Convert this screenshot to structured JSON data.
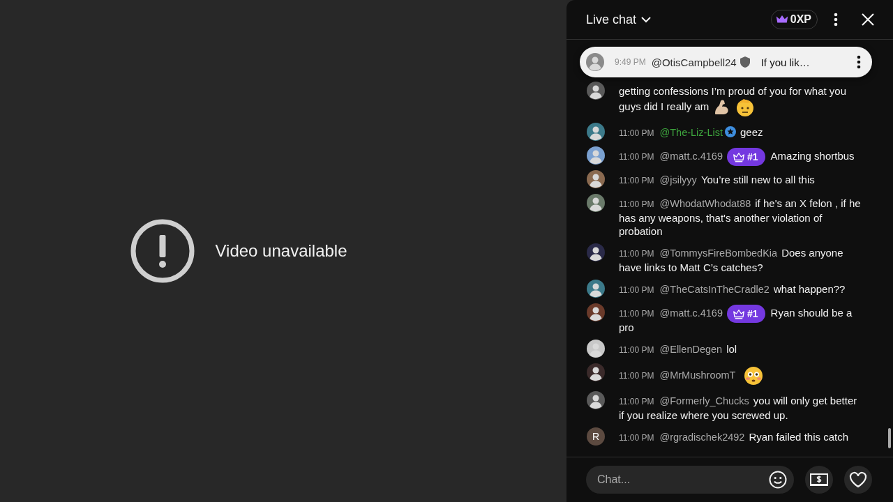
{
  "player": {
    "message": "Video unavailable"
  },
  "chat": {
    "title": "Live chat",
    "xp": "0XP",
    "pinned": {
      "time": "9:49 PM",
      "author": "@OtisCampbell24",
      "moderator": true,
      "text": "If you lik…"
    },
    "messages": [
      {
        "kind": "continuation",
        "text": "getting confessions I’m proud of you for what you guys did I really am",
        "emojis": [
          {
            "kind": "flexed-arm"
          },
          {
            "kind": "saluting-face"
          }
        ]
      },
      {
        "kind": "message",
        "time": "11:00 PM",
        "author": "@The-Liz-List",
        "color": "#3ea63e",
        "verified": true,
        "text": "geez"
      },
      {
        "kind": "message",
        "time": "11:00 PM",
        "author": "@matt.c.4169",
        "color": "#aaaaaa",
        "verified": false,
        "badge": "#1",
        "text": "Amazing shortbus"
      },
      {
        "kind": "message",
        "time": "11:00 PM",
        "author": "@jsilyyy",
        "color": "#aaaaaa",
        "verified": false,
        "text": "You’re still new to all this"
      },
      {
        "kind": "message",
        "time": "11:00 PM",
        "author": "@WhodatWhodat88",
        "color": "#aaaaaa",
        "verified": false,
        "text": "if he's an X felon , if he has any weapons, that's another violation of probation"
      },
      {
        "kind": "message",
        "time": "11:00 PM",
        "author": "@TommysFireBombedKia",
        "color": "#aaaaaa",
        "verified": false,
        "text": "Does anyone have links to Matt C’s catches?"
      },
      {
        "kind": "message",
        "time": "11:00 PM",
        "author": "@TheCatsInTheCradle2",
        "color": "#aaaaaa",
        "verified": false,
        "text": "what happen??"
      },
      {
        "kind": "message",
        "time": "11:00 PM",
        "author": "@matt.c.4169",
        "color": "#aaaaaa",
        "verified": false,
        "badge": "#1",
        "text": "Ryan should be a pro"
      },
      {
        "kind": "message",
        "time": "11:00 PM",
        "author": "@EllenDegen",
        "color": "#aaaaaa",
        "verified": false,
        "text": "lol"
      },
      {
        "kind": "message",
        "time": "11:00 PM",
        "author": "@MrMushroomT",
        "color": "#aaaaaa",
        "verified": false,
        "emojis": [
          {
            "kind": "flushed-face"
          }
        ]
      },
      {
        "kind": "message",
        "time": "11:00 PM",
        "author": "@Formerly_Chucks",
        "color": "#aaaaaa",
        "verified": false,
        "text": "you will only get better if you realize where you screwed up."
      },
      {
        "kind": "message",
        "initial": "R",
        "time": "11:00 PM",
        "author": "@rgradischek2492",
        "color": "#aaaaaa",
        "verified": false,
        "text": "Ryan failed this catch"
      }
    ],
    "input": {
      "placeholder": "Chat..."
    }
  }
}
